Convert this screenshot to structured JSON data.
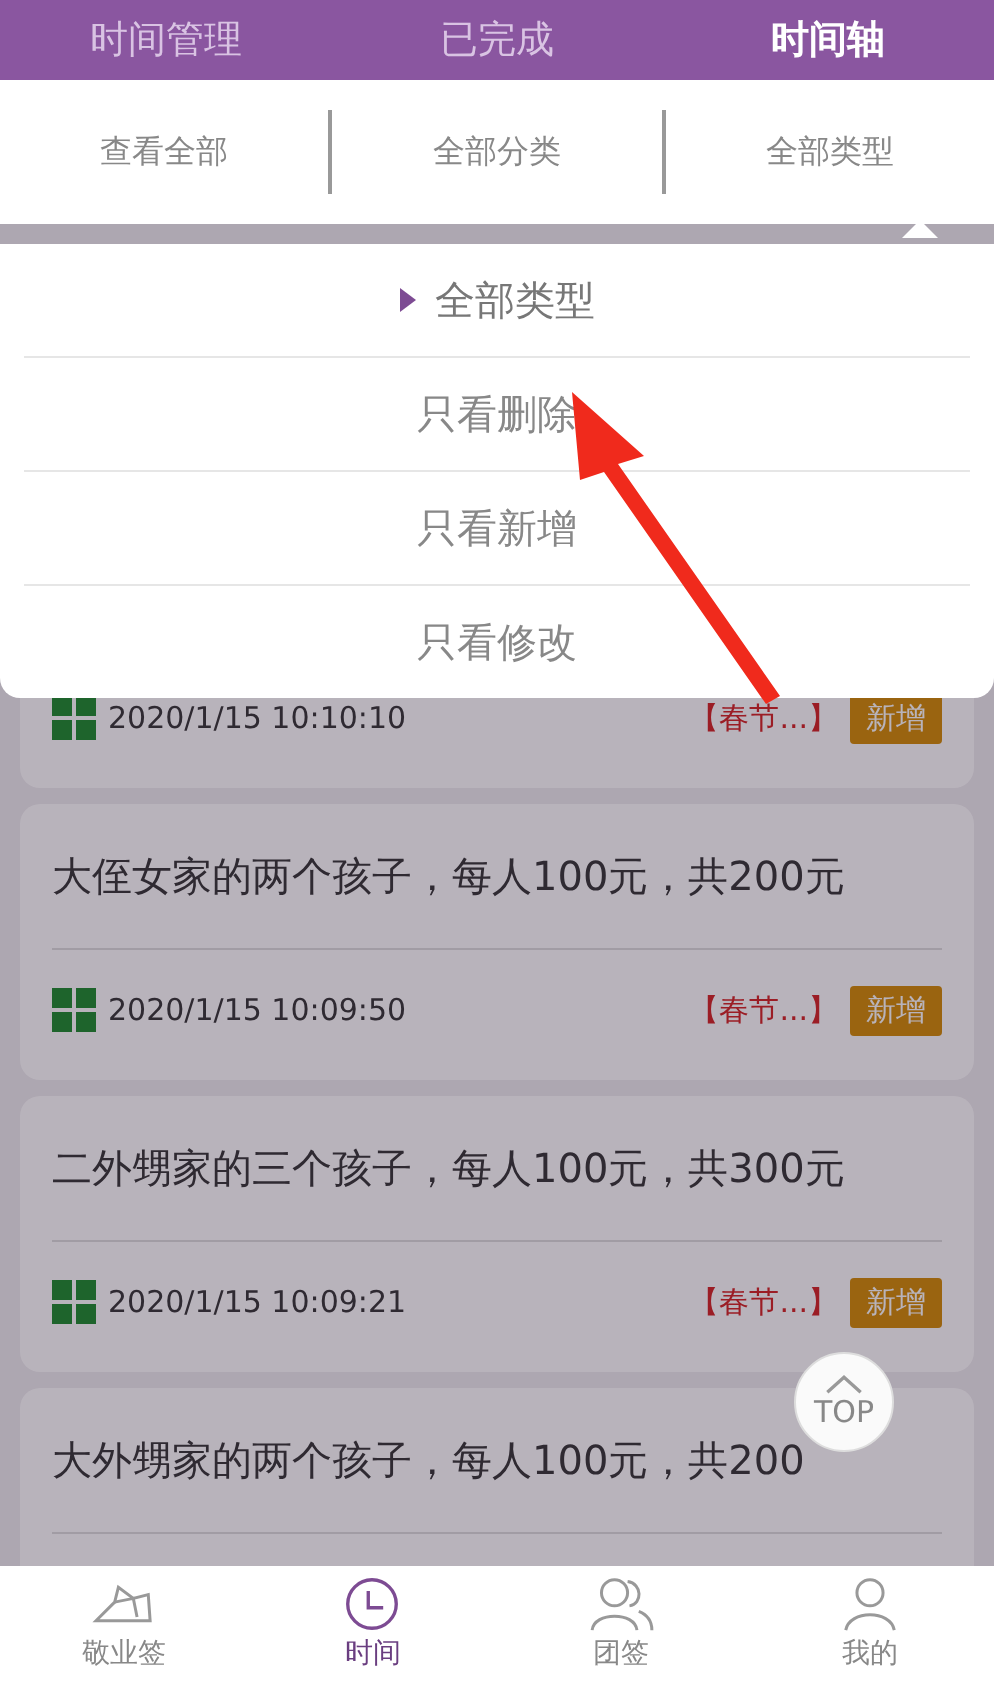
{
  "top_tabs": [
    {
      "label": "时间管理",
      "selected": false
    },
    {
      "label": "已完成",
      "selected": false
    },
    {
      "label": "时间轴",
      "selected": true
    }
  ],
  "filters": [
    {
      "label": "查看全部",
      "expanded": false
    },
    {
      "label": "全部分类",
      "expanded": false
    },
    {
      "label": "全部类型",
      "expanded": true
    }
  ],
  "dropdown": {
    "items": [
      {
        "label": "全部类型",
        "selected": true
      },
      {
        "label": "只看删除",
        "selected": false
      },
      {
        "label": "只看新增",
        "selected": false
      },
      {
        "label": "只看修改",
        "selected": false
      }
    ]
  },
  "entries": [
    {
      "time": "2020/1/15 10:10:10",
      "tag": "【春节...】",
      "badge": "新增"
    },
    {
      "title": "大侄女家的两个孩子，每人100元，共200元",
      "time": "2020/1/15 10:09:50",
      "tag": "【春节...】",
      "badge": "新增"
    },
    {
      "title": "二外甥家的三个孩子，每人100元，共300元",
      "time": "2020/1/15 10:09:21",
      "tag": "【春节...】",
      "badge": "新增"
    },
    {
      "title": "大外甥家的两个孩子，每人100元，共200"
    }
  ],
  "top_button": {
    "label": "TOP"
  },
  "bottom_nav": [
    {
      "label": "敬业签",
      "selected": false
    },
    {
      "label": "时间",
      "selected": true
    },
    {
      "label": "团签",
      "selected": false
    },
    {
      "label": "我的",
      "selected": false
    }
  ]
}
